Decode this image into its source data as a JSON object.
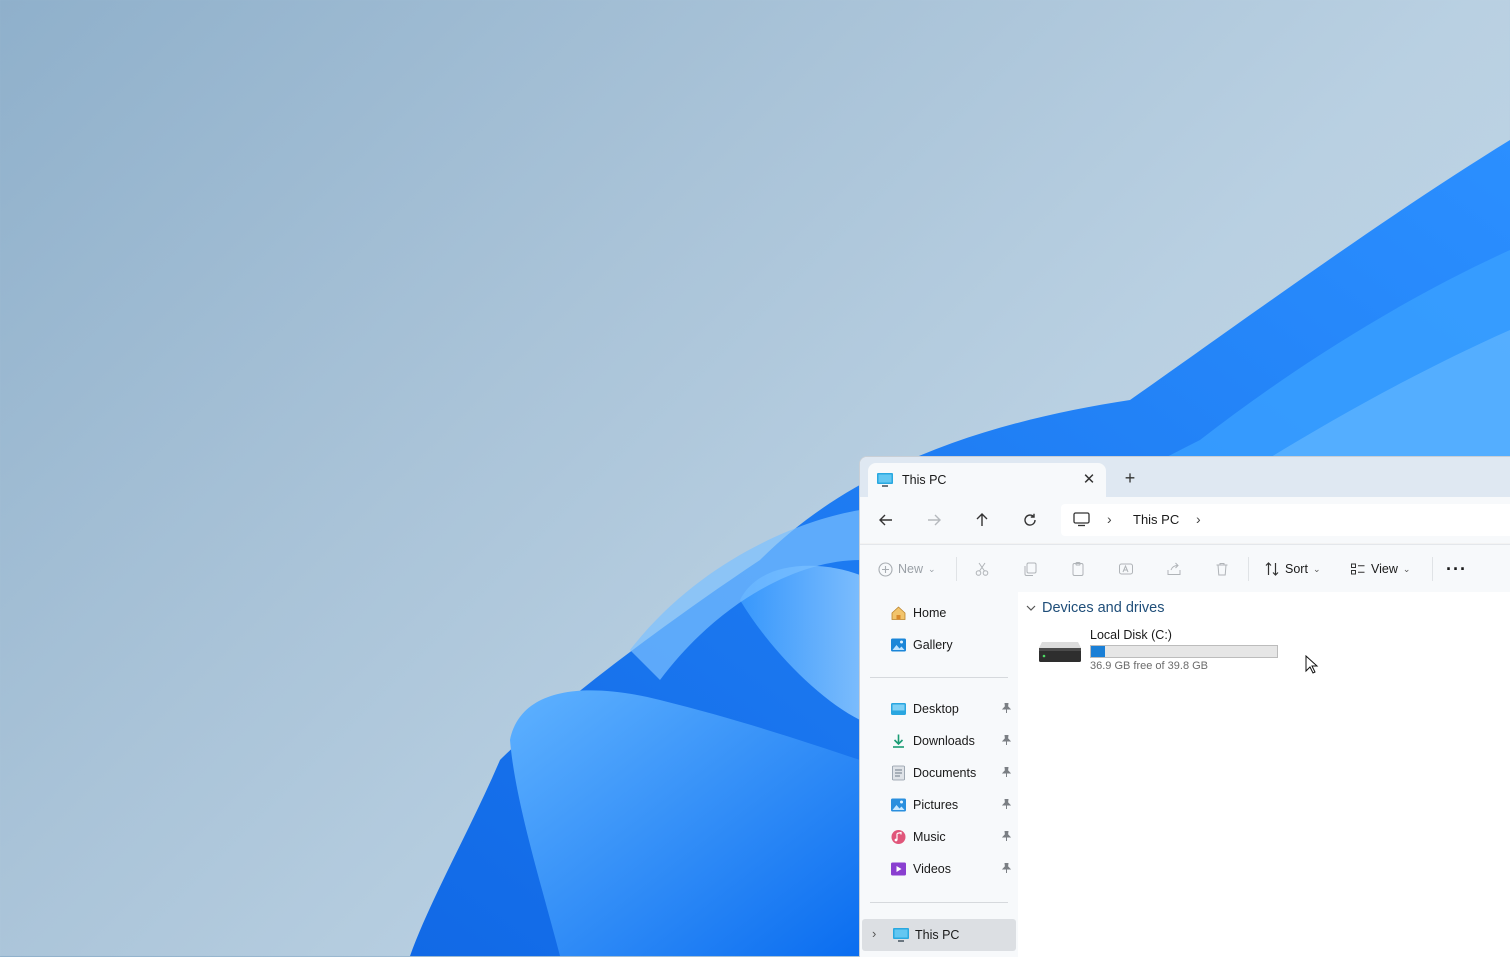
{
  "window": {
    "icon": "monitor-icon"
  },
  "tabs": [
    {
      "label": "This PC",
      "icon": "this-pc-icon"
    }
  ],
  "address": {
    "crumbs": [
      "This PC"
    ]
  },
  "toolbar": {
    "new_label": "New",
    "sort_label": "Sort",
    "view_label": "View"
  },
  "sidebar": {
    "top": [
      {
        "label": "Home",
        "icon": "home-icon"
      },
      {
        "label": "Gallery",
        "icon": "gallery-icon"
      }
    ],
    "quick": [
      {
        "label": "Desktop",
        "icon": "desktop-icon",
        "pinned": true
      },
      {
        "label": "Downloads",
        "icon": "downloads-icon",
        "pinned": true
      },
      {
        "label": "Documents",
        "icon": "documents-icon",
        "pinned": true
      },
      {
        "label": "Pictures",
        "icon": "pictures-icon",
        "pinned": true
      },
      {
        "label": "Music",
        "icon": "music-icon",
        "pinned": true
      },
      {
        "label": "Videos",
        "icon": "videos-icon",
        "pinned": true
      }
    ],
    "thispc": {
      "label": "This PC",
      "icon": "this-pc-icon"
    }
  },
  "content": {
    "section_title": "Devices and drives",
    "drives": [
      {
        "name": "Local Disk (C:)",
        "free_text": "36.9 GB free of 39.8 GB",
        "used_fraction": 0.073
      }
    ]
  },
  "colors": {
    "accent": "#1a7fd6",
    "wallpaper_blue": "#1e88ff"
  }
}
